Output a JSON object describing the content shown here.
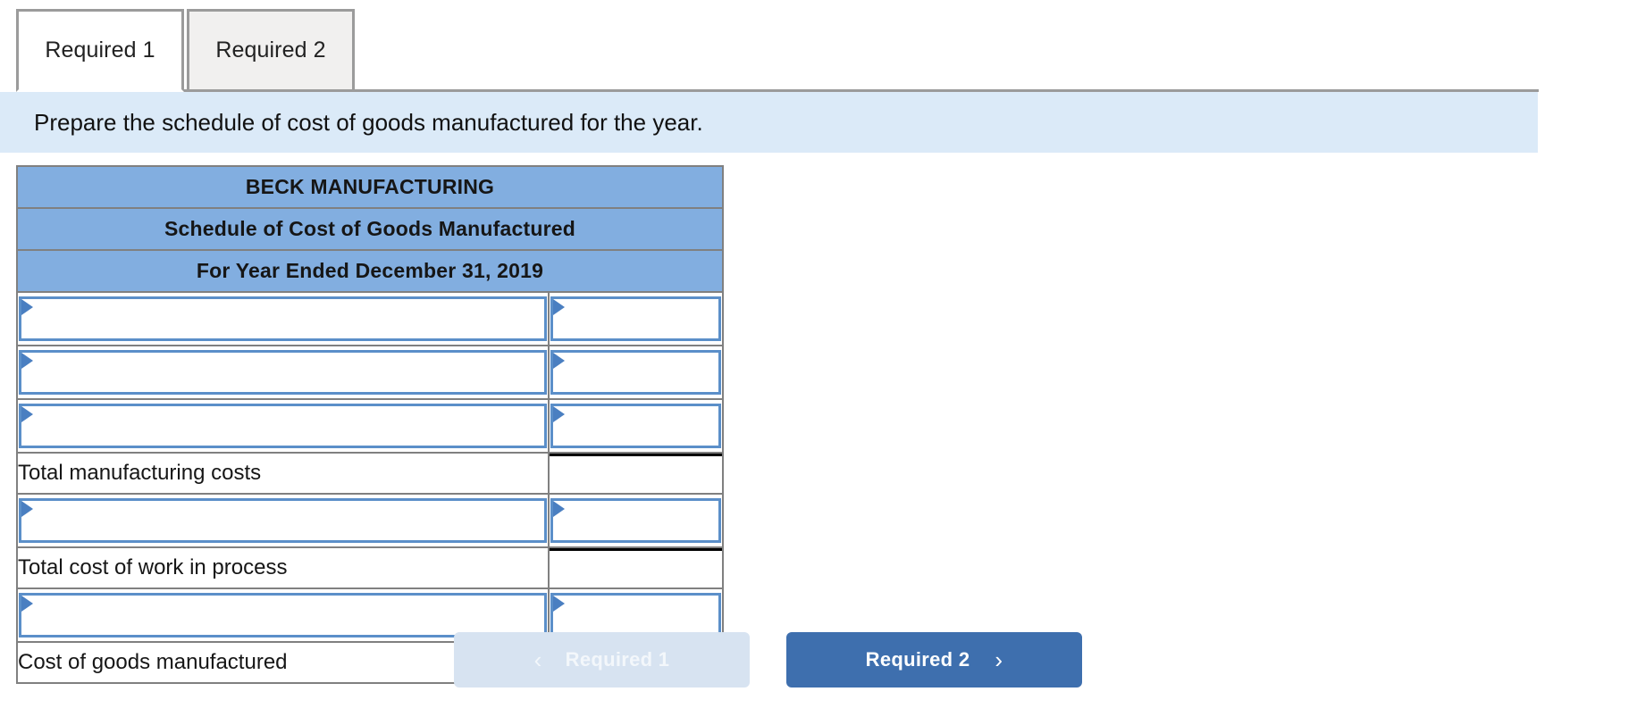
{
  "tabs": [
    {
      "label": "Required 1",
      "active": true
    },
    {
      "label": "Required 2",
      "active": false
    }
  ],
  "instruction": "Prepare the schedule of cost of goods manufactured for the year.",
  "worksheet": {
    "header_lines": [
      "BECK MANUFACTURING",
      "Schedule of Cost of Goods Manufactured",
      "For Year Ended December 31, 2019"
    ],
    "rows": [
      {
        "type": "dropdown",
        "label": "",
        "value": ""
      },
      {
        "type": "dropdown",
        "label": "",
        "value": ""
      },
      {
        "type": "dropdown",
        "label": "",
        "value": ""
      },
      {
        "type": "total",
        "label": "Total manufacturing costs",
        "value": ""
      },
      {
        "type": "dropdown",
        "label": "",
        "value": ""
      },
      {
        "type": "total",
        "label": "Total cost of work in process",
        "value": ""
      },
      {
        "type": "dropdown",
        "label": "",
        "value": ""
      },
      {
        "type": "grand",
        "label": "Cost of goods manufactured",
        "value": ""
      }
    ]
  },
  "footer": {
    "prev_label": "Required 1",
    "next_label": "Required 2",
    "prev_chevron": "‹",
    "next_chevron": "›"
  },
  "colors": {
    "header_blue": "#82AEDE",
    "instruction_blue": "#DBEAF8",
    "dropdown_border": "#5B8FC9",
    "next_button": "#3E6FAE",
    "prev_button": "#D7E3F1"
  }
}
